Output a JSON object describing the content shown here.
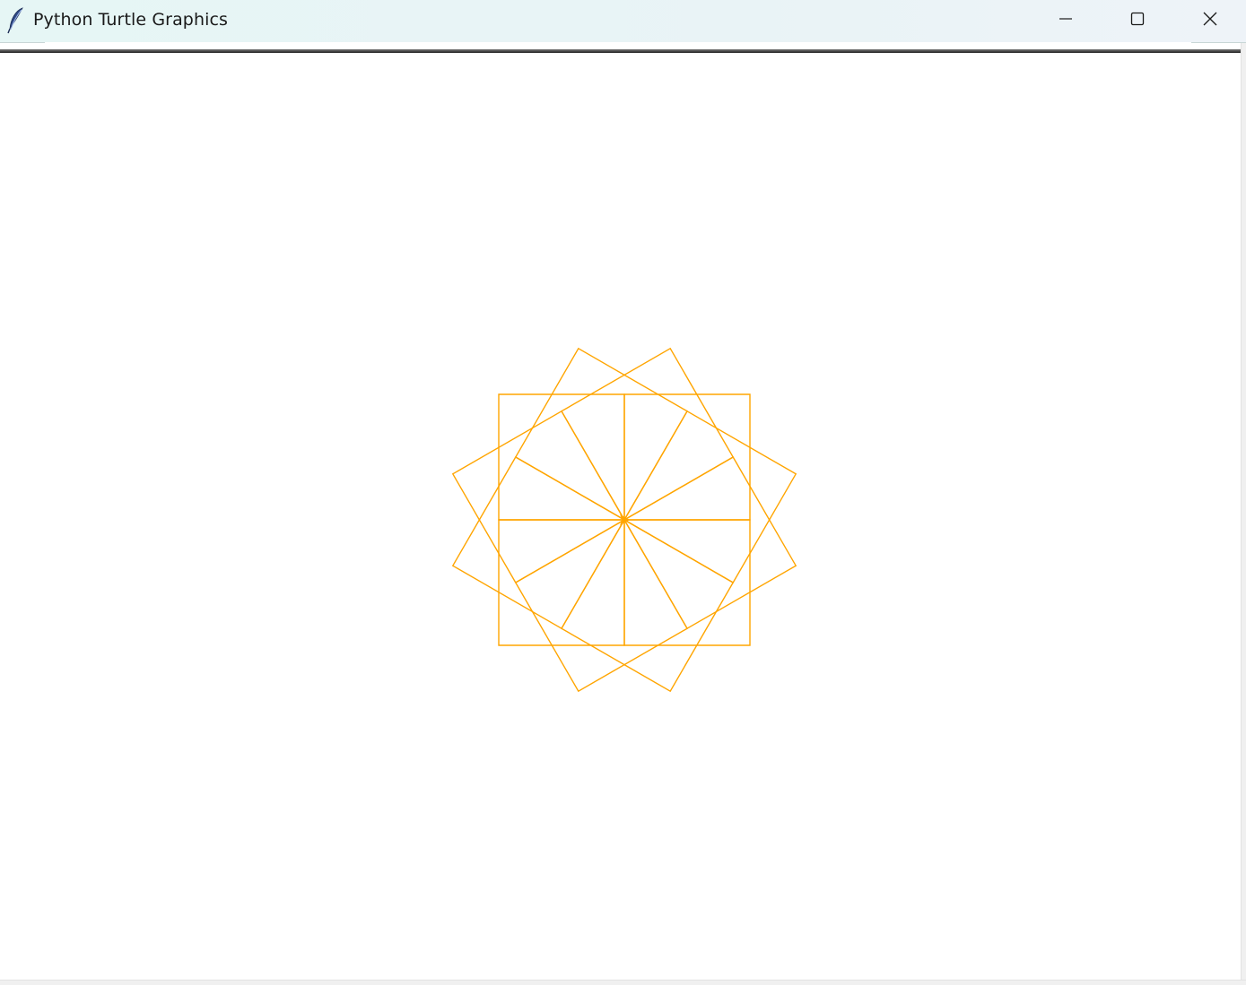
{
  "window": {
    "title": "Python Turtle Graphics",
    "icon": "feather-icon",
    "controls": {
      "minimize": "minimize-icon",
      "maximize": "maximize-icon",
      "close": "close-icon"
    }
  },
  "canvas": {
    "background_color": "#ffffff",
    "pen_color": "#ffa500",
    "turtle_shape": "classic-arrow",
    "drawing": {
      "shape": "square",
      "square_count": 12,
      "side_length": 140,
      "rotation_step_degrees": 30
    }
  }
}
